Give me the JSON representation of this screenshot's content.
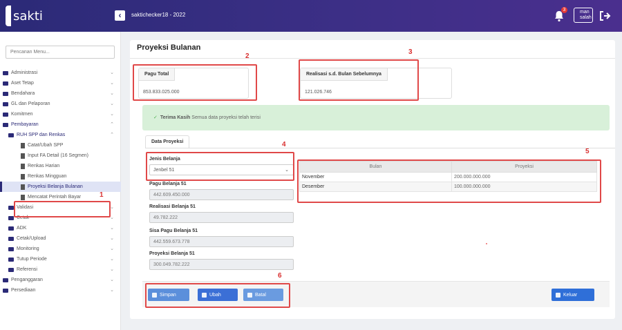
{
  "header": {
    "app_name": "sakti",
    "breadcrumb": "saktichecker18 - 2022",
    "notif_count": "3",
    "user_label": "man salah"
  },
  "sidebar": {
    "search_placeholder": "Pencarian Menu...",
    "items": [
      {
        "label": "Administrasi"
      },
      {
        "label": "Aset Tetap"
      },
      {
        "label": "Bendahara"
      },
      {
        "label": "GL dan Pelaporan"
      },
      {
        "label": "Komitmen"
      },
      {
        "label": "Pembayaran"
      },
      {
        "label": "RUH SPP dan Renkas"
      },
      {
        "label": "Catat/Ubah SPP"
      },
      {
        "label": "Input FA Detail (16 Segmen)"
      },
      {
        "label": "Renkas Harian"
      },
      {
        "label": "Renkas Mingguan"
      },
      {
        "label": "Proyeksi Belanja Bulanan"
      },
      {
        "label": "Mencatat Perintah Bayar"
      },
      {
        "label": "Validasi"
      },
      {
        "label": "Cetak"
      },
      {
        "label": "ADK"
      },
      {
        "label": "Cetak/Upload"
      },
      {
        "label": "Monitoring"
      },
      {
        "label": "Tutup Periode"
      },
      {
        "label": "Referensi"
      },
      {
        "label": "Penganggaran"
      },
      {
        "label": "Persediaan"
      }
    ]
  },
  "page": {
    "title": "Proyeksi Bulanan",
    "pagu_total_label": "Pagu Total",
    "pagu_total_value": "853.833.025.000",
    "realisasi_label": "Realisasi s.d. Bulan Sebelumnya",
    "realisasi_value": "121.026.746",
    "alert_bold": "Terima Kasih",
    "alert_text": "Semua data proyeksi telah terisi",
    "tab_label": "Data Proyeksi",
    "jenis_label": "Jenis Belanja",
    "jenis_value": "Jenbel 51",
    "pagu_belanja_label": "Pagu Belanja 51",
    "pagu_belanja_value": "442.609.450.000",
    "realisasi_belanja_label": "Realisasi Belanja 51",
    "realisasi_belanja_value": "49.782.222",
    "sisa_label": "Sisa Pagu Belanja 51",
    "sisa_value": "442.559.673.778",
    "proyeksi_label": "Proyeksi Belanja 51",
    "proyeksi_value": "300.049.782.222",
    "table": {
      "headers": [
        "Bulan",
        "Proyeksi"
      ],
      "rows": [
        {
          "bulan": "November",
          "proyeksi": "200.000.000.000"
        },
        {
          "bulan": "Desember",
          "proyeksi": "100.000.000.000"
        }
      ]
    },
    "buttons": {
      "simpan": "Simpan",
      "ubah": "Ubah",
      "batal": "Batal",
      "keluar": "Keluar"
    }
  },
  "annotations": [
    "1",
    "2",
    "3",
    "4",
    "5",
    "6"
  ]
}
